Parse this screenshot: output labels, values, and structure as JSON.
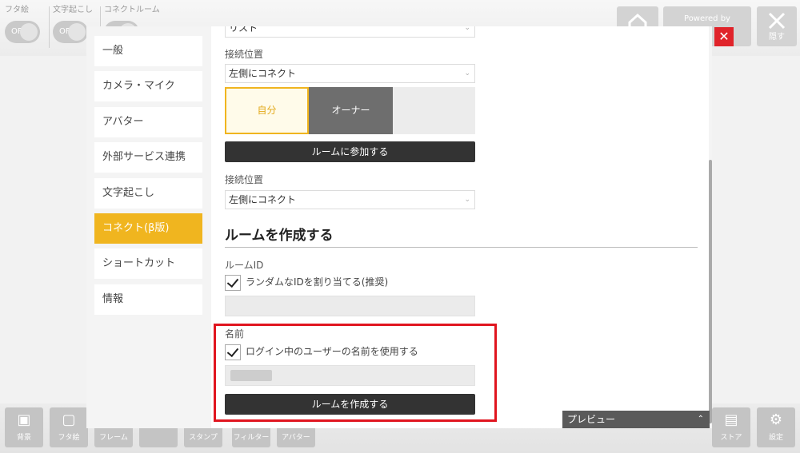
{
  "top_bar": {
    "toggles": [
      {
        "label": "フタ絵",
        "state": "OFF"
      },
      {
        "label": "文字起こし",
        "state": "OFF"
      },
      {
        "label": "コネクトルーム",
        "state": ""
      }
    ],
    "powered_by": "Powered by",
    "close_label": "隠す"
  },
  "sidebar": {
    "items": [
      {
        "label": "一般"
      },
      {
        "label": "カメラ・マイク"
      },
      {
        "label": "アバター"
      },
      {
        "label": "外部サービス連携"
      },
      {
        "label": "文字起こし"
      },
      {
        "label": "コネクト(β版)"
      },
      {
        "label": "ショートカット"
      },
      {
        "label": "情報"
      }
    ]
  },
  "join_room": {
    "list_select_value": "リスト",
    "connect_position_label": "接続位置",
    "connect_position_value": "左側にコネクト",
    "segment": {
      "self_label": "自分",
      "owner_label": "オーナー"
    },
    "join_button_label": "ルームに参加する",
    "connect_position_label_2": "接続位置",
    "connect_position_value_2": "左側にコネクト"
  },
  "create_room": {
    "title": "ルームを作成する",
    "room_id_label": "ルームID",
    "random_id_label": "ランダムなIDを割り当てる(推奨)",
    "random_id_checked": true,
    "name_label": "名前",
    "use_login_name_label": "ログイン中のユーザーの名前を使用する",
    "use_login_name_checked": true,
    "create_button_label": "ルームを作成する"
  },
  "preview": {
    "label": "プレビュー"
  },
  "bottom_tools": [
    {
      "label": "背景",
      "icon": "background-icon"
    },
    {
      "label": "フタ絵",
      "icon": "cover-image-icon"
    },
    {
      "label": "フレーム",
      "icon": "frame-icon"
    },
    {
      "label": "",
      "icon": "blank-tool-icon"
    },
    {
      "label": "スタンプ",
      "icon": "stamp-icon"
    },
    {
      "label": "フィルター",
      "icon": "filter-icon"
    },
    {
      "label": "アバター",
      "icon": "avatar-icon"
    }
  ],
  "bottom_right_tools": [
    {
      "label": "ストア",
      "icon": "store-icon"
    },
    {
      "label": "設定",
      "icon": "gear-icon"
    }
  ],
  "colors": {
    "accent": "#f0b51f",
    "highlight": "#e0151f",
    "dark_button": "#333333"
  }
}
